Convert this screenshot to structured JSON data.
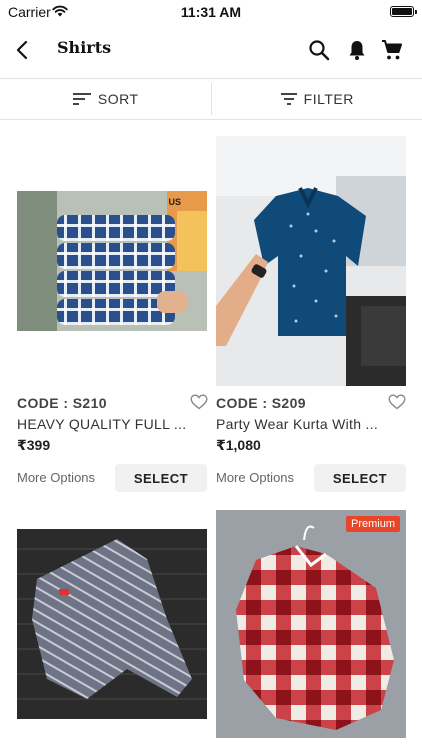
{
  "status_bar": {
    "carrier": "Carrier",
    "time": "11:31 AM"
  },
  "nav": {
    "title": "Shirts"
  },
  "toolbar": {
    "sort_label": "SORT",
    "filter_label": "FILTER"
  },
  "products": [
    {
      "code": "CODE : S210",
      "name": "HEAVY QUALITY FULL ...",
      "price": "₹399",
      "more_options": "More Options",
      "select_label": "SELECT",
      "image_label": "US"
    },
    {
      "code": "CODE : S209",
      "name": "Party Wear Kurta With ...",
      "price": "₹1,080",
      "more_options": "More Options",
      "select_label": "SELECT"
    },
    {
      "badge": "Premium"
    }
  ],
  "icons": [
    "back-icon",
    "search-icon",
    "bell-icon",
    "cart-icon",
    "sort-icon",
    "filter-icon",
    "heart-icon"
  ]
}
